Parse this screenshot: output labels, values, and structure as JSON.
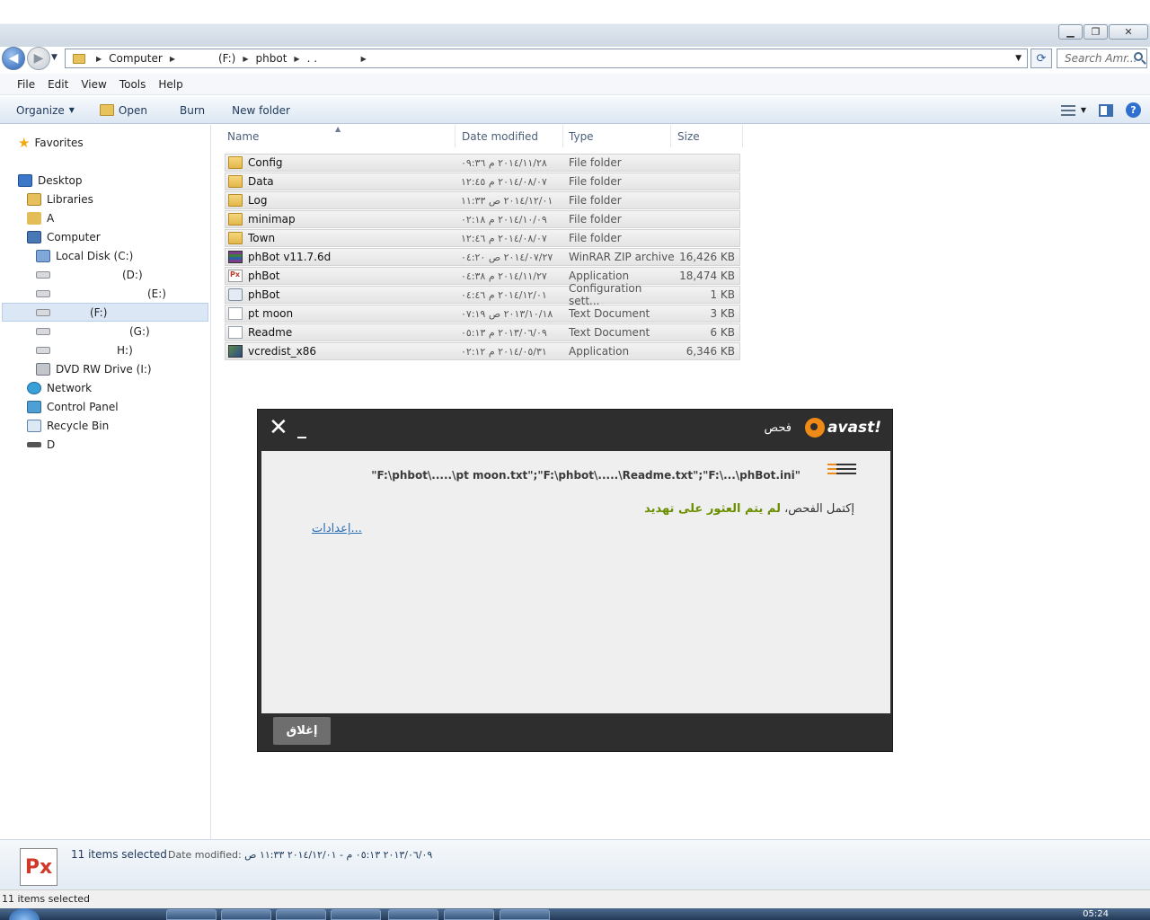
{
  "window": {
    "controls": {
      "minimize": "▁",
      "maximize": "❐",
      "close": "✕"
    }
  },
  "nav": {
    "breadcrumbs": [
      "Computer",
      "(F:)",
      "phbot",
      ". ."
    ],
    "search_placeholder": "Search Amr..."
  },
  "menu": [
    "File",
    "Edit",
    "View",
    "Tools",
    "Help"
  ],
  "toolbar": {
    "organize": "Organize",
    "open": "Open",
    "burn": "Burn",
    "new_folder": "New folder"
  },
  "sidebar": {
    "favorites": "Favorites",
    "desktop": "Desktop",
    "libraries": "Libraries",
    "user": "A",
    "computer": "Computer",
    "drives": [
      {
        "label": "Local Disk (C:)"
      },
      {
        "label": "(D:)"
      },
      {
        "label": "(E:)"
      },
      {
        "label": "(F:)"
      },
      {
        "label": "(G:)"
      },
      {
        "label": "H:)"
      },
      {
        "label": "DVD RW Drive (I:)"
      }
    ],
    "network": "Network",
    "control_panel": "Control Panel",
    "recycle_bin": "Recycle Bin",
    "last": "D"
  },
  "columns": {
    "name": "Name",
    "date": "Date modified",
    "type": "Type",
    "size": "Size"
  },
  "files": [
    {
      "name": "Config",
      "date": "٢٠١٤/١١/٢٨ م ٠٩:٣٦",
      "type": "File folder",
      "size": "",
      "icon": "folder"
    },
    {
      "name": "Data",
      "date": "٢٠١٤/٠٨/٠٧ م ١٢:٤٥",
      "type": "File folder",
      "size": "",
      "icon": "folder"
    },
    {
      "name": "Log",
      "date": "٢٠١٤/١٢/٠١ ص ١١:٣٣",
      "type": "File folder",
      "size": "",
      "icon": "folder"
    },
    {
      "name": "minimap",
      "date": "٢٠١٤/١٠/٠٩ م ٠٢:١٨",
      "type": "File folder",
      "size": "",
      "icon": "folder"
    },
    {
      "name": "Town",
      "date": "٢٠١٤/٠٨/٠٧ م ١٢:٤٦",
      "type": "File folder",
      "size": "",
      "icon": "folder"
    },
    {
      "name": "phBot v11.7.6d",
      "date": "٢٠١٤/٠٧/٢٧ ص ٠٤:٢٠",
      "type": "WinRAR ZIP archive",
      "size": "16,426 KB",
      "icon": "rar"
    },
    {
      "name": "phBot",
      "date": "٢٠١٤/١١/٢٧ م ٠٤:٣٨",
      "type": "Application",
      "size": "18,474 KB",
      "icon": "app"
    },
    {
      "name": "phBot",
      "date": "٢٠١٤/١٢/٠١ م ٠٤:٤٦",
      "type": "Configuration sett...",
      "size": "1 KB",
      "icon": "cfg"
    },
    {
      "name": "pt moon",
      "date": "٢٠١٣/١٠/١٨ ص ٠٧:١٩",
      "type": "Text Document",
      "size": "3 KB",
      "icon": "txt"
    },
    {
      "name": "Readme",
      "date": "٢٠١٣/٠٦/٠٩ م ٠٥:١٣",
      "type": "Text Document",
      "size": "6 KB",
      "icon": "txt"
    },
    {
      "name": "vcredist_x86",
      "date": "٢٠١٤/٠٥/٣١ م ٠٢:١٢",
      "type": "Application",
      "size": "6,346 KB",
      "icon": "setup"
    }
  ],
  "avast": {
    "title": "فحص",
    "brand": "avast!",
    "paths": "\"F:\\phbot\\.....\\pt moon.txt\";\"F:\\phbot\\.....\\Readme.txt\";\"F:\\...\\phBot.ini\"",
    "result_prefix": "إكتمل الفحص،",
    "result_highlight": "لم يتم العثور على تهديد",
    "settings_link": "إعدادات...",
    "close_button": "إغلاق"
  },
  "details": {
    "thumb": "Px",
    "selection": "11 items selected",
    "date_label": "Date modified:",
    "date_value": "٢٠١٣/٠٦/٠٩ ٠٥:١٣ م - ٢٠١٤/١٢/٠١ ١١:٣٣ ص"
  },
  "status": {
    "text": "11 items selected"
  },
  "taskbar": {
    "clock": "05:24"
  }
}
